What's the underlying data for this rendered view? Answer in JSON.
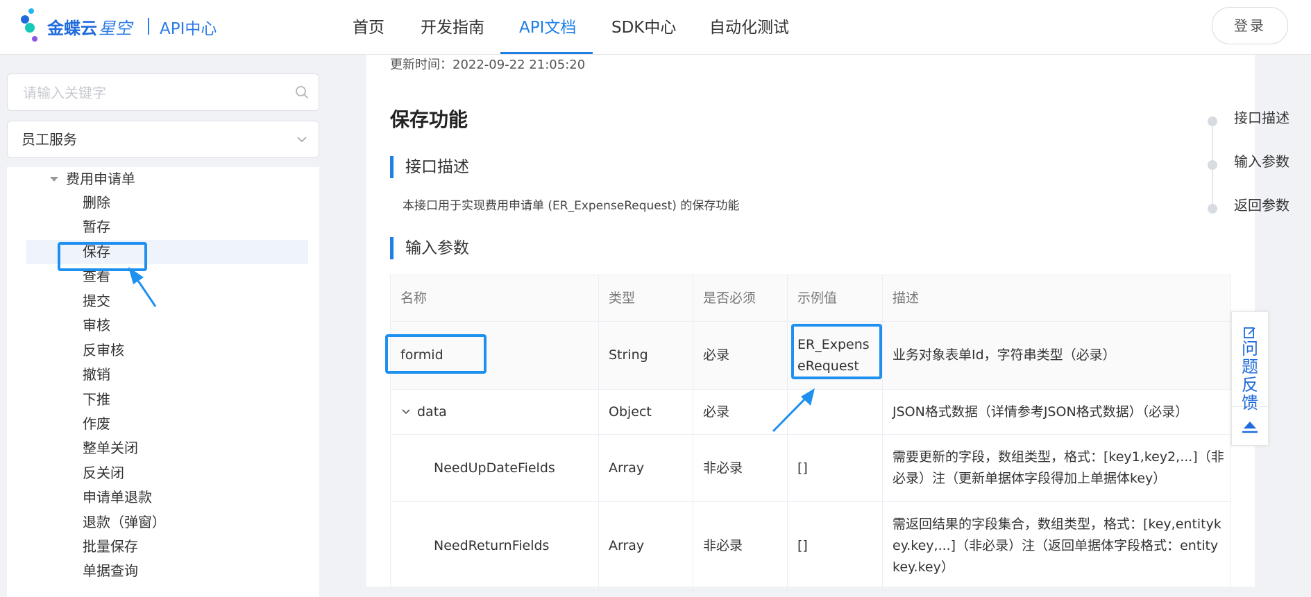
{
  "header": {
    "logo_brand": "金蝶云",
    "logo_product": "星空",
    "logo_sub": "API中心",
    "nav": [
      {
        "label": "首页"
      },
      {
        "label": "开发指南"
      },
      {
        "label": "API文档"
      },
      {
        "label": "SDK中心"
      },
      {
        "label": "自动化测试"
      }
    ],
    "active_nav": "API文档",
    "login_label": "登录",
    "accent_color": "#1f7ee6"
  },
  "sidebar": {
    "search_placeholder": "请输入关键字",
    "service_select": "员工服务",
    "tree_parent": "费用申请单",
    "items": [
      {
        "label": "删除"
      },
      {
        "label": "暂存"
      },
      {
        "label": "保存"
      },
      {
        "label": "查看"
      },
      {
        "label": "提交"
      },
      {
        "label": "审核"
      },
      {
        "label": "反审核"
      },
      {
        "label": "撤销"
      },
      {
        "label": "下推"
      },
      {
        "label": "作废"
      },
      {
        "label": "整单关闭"
      },
      {
        "label": "反关闭"
      },
      {
        "label": "申请单退款"
      },
      {
        "label": "退款（弹窗）"
      },
      {
        "label": "批量保存"
      },
      {
        "label": "单据查询"
      }
    ],
    "selected_item": "保存"
  },
  "main": {
    "update_time": "更新时间：2022-09-22 21:05:20",
    "title": "保存功能",
    "section_desc_title": "接口描述",
    "description": "本接口用于实现费用申请单 (ER_ExpenseRequest) 的保存功能",
    "section_input_title": "输入参数",
    "table": {
      "headers": [
        "名称",
        "类型",
        "是否必须",
        "示例值",
        "描述"
      ],
      "rows": [
        {
          "name": "formid",
          "type": "String",
          "required": "必录",
          "example": "ER_ExpenseRequest",
          "desc": "业务对象表单Id，字符串类型（必录）"
        },
        {
          "name": "data",
          "type": "Object",
          "required": "必录",
          "example": "",
          "desc": "JSON格式数据（详情参考JSON格式数据）（必录）"
        },
        {
          "name": "NeedUpDateFields",
          "type": "Array",
          "required": "非必录",
          "example": "[]",
          "desc": "需要更新的字段，数组类型，格式：[key1,key2,...]（非必录）注（更新单据体字段得加上单据体key）"
        },
        {
          "name": "NeedReturnFields",
          "type": "Array",
          "required": "非必录",
          "example": "[]",
          "desc": "需返回结果的字段集合，数组类型，格式：[key,entitykey.key,...]（非必录）注（返回单据体字段格式：entitykey.key）"
        }
      ]
    }
  },
  "anchor_nav": [
    {
      "label": "接口描述"
    },
    {
      "label": "输入参数"
    },
    {
      "label": "返回参数"
    }
  ],
  "feedback": {
    "label": "问题反馈",
    "icon": "edit-icon",
    "top_icon": "back-to-top-icon"
  },
  "annotation_color": "#1e90f0"
}
